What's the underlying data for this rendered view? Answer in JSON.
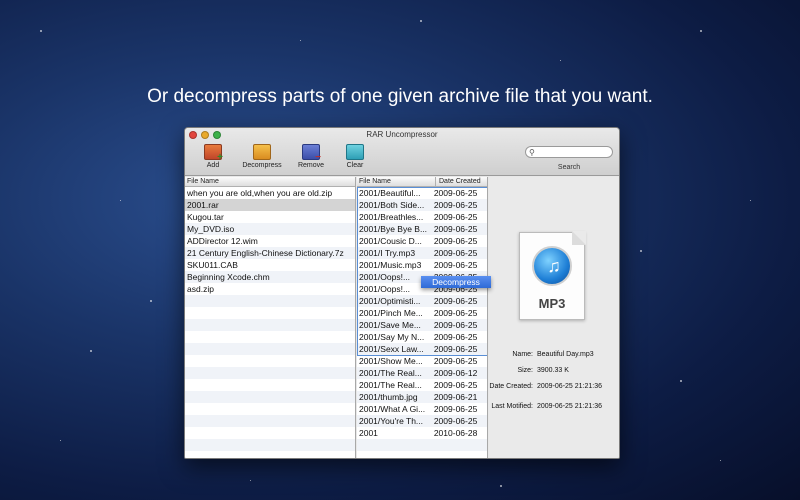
{
  "headline": "Or decompress parts of one given archive file that you want.",
  "window": {
    "title": "RAR Uncompressor",
    "toolbar": {
      "add": "Add",
      "decompress": "Decompress",
      "remove": "Remove",
      "clear": "Clear"
    },
    "search": {
      "label": "Search",
      "value": ""
    }
  },
  "left_pane": {
    "header": "File Name",
    "selected_index": 1,
    "files": [
      "when you are old,when you are old.zip",
      "2001.rar",
      "Kugou.tar",
      "My_DVD.iso",
      "ADDirector 12.wim",
      "21 Century English-Chinese Dictionary.7z",
      "SKU011.CAB",
      "Beginning Xcode.chm",
      "asd.zip"
    ]
  },
  "mid_pane": {
    "headers": [
      "File Name",
      "Date Created"
    ],
    "rows": [
      [
        "2001/Beautiful...",
        "2009-06-25"
      ],
      [
        "2001/Both Side...",
        "2009-06-25"
      ],
      [
        "2001/Breathles...",
        "2009-06-25"
      ],
      [
        "2001/Bye Bye B...",
        "2009-06-25"
      ],
      [
        "2001/Cousic D...",
        "2009-06-25"
      ],
      [
        "2001/I Try.mp3",
        "2009-06-25"
      ],
      [
        "2001/Music.mp3",
        "2009-06-25"
      ],
      [
        "2001/Oops!...",
        "2009-06-25"
      ],
      [
        "2001/Oops!...",
        "2009-06-25"
      ],
      [
        "2001/Optimisti...",
        "2009-06-25"
      ],
      [
        "2001/Pinch Me...",
        "2009-06-25"
      ],
      [
        "2001/Save Me...",
        "2009-06-25"
      ],
      [
        "2001/Say My N...",
        "2009-06-25"
      ],
      [
        "2001/Sexx Law...",
        "2009-06-25"
      ],
      [
        "2001/Show Me...",
        "2009-06-25"
      ],
      [
        "2001/The Real...",
        "2009-06-12"
      ],
      [
        "2001/The Real...",
        "2009-06-25"
      ],
      [
        "2001/thumb.jpg",
        "2009-06-21"
      ],
      [
        "2001/What A Gi...",
        "2009-06-25"
      ],
      [
        "2001/You're Th...",
        "2009-06-25"
      ],
      [
        "2001",
        "2010-06-28"
      ]
    ],
    "context_menu": "Decompress"
  },
  "detail": {
    "icon_label": "MP3",
    "name_key": "Name:",
    "name": "Beautiful Day.mp3",
    "size_key": "Size:",
    "size": "3900.33 K",
    "created_key": "Date Created:",
    "created": "2009-06-25 21:21:36",
    "modified_key": "Last Motified:",
    "modified": "2009-06-25 21:21:36"
  }
}
